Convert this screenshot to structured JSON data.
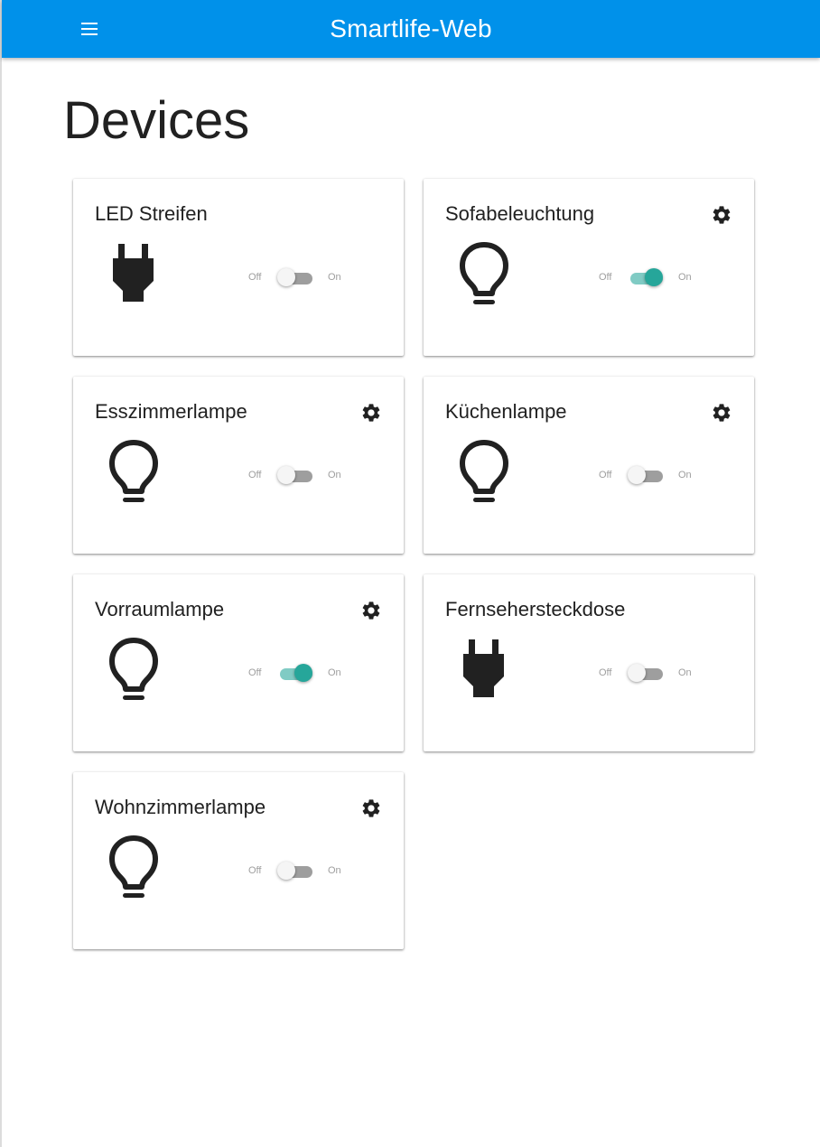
{
  "app": {
    "title": "Smartlife-Web",
    "menu_icon": "hamburger-menu-icon"
  },
  "page": {
    "title": "Devices"
  },
  "toggle_labels": {
    "off": "Off",
    "on": "On"
  },
  "colors": {
    "appbar": "#0091ea",
    "switch_on": "#26a69a",
    "switch_on_track": "#80cbc4",
    "switch_off_track": "#9e9e9e"
  },
  "devices": [
    {
      "name": "LED Streifen",
      "type": "plug",
      "icon": "plug-icon",
      "has_settings": false,
      "on": false
    },
    {
      "name": "Sofabeleuchtung",
      "type": "light",
      "icon": "lightbulb-icon",
      "has_settings": true,
      "on": true
    },
    {
      "name": "Esszimmerlampe",
      "type": "light",
      "icon": "lightbulb-icon",
      "has_settings": true,
      "on": false
    },
    {
      "name": "Küchenlampe",
      "type": "light",
      "icon": "lightbulb-icon",
      "has_settings": true,
      "on": false
    },
    {
      "name": "Vorraumlampe",
      "type": "light",
      "icon": "lightbulb-icon",
      "has_settings": true,
      "on": true
    },
    {
      "name": "Fernsehersteckdose",
      "type": "plug",
      "icon": "plug-icon",
      "has_settings": false,
      "on": false
    },
    {
      "name": "Wohnzimmerlampe",
      "type": "light",
      "icon": "lightbulb-icon",
      "has_settings": true,
      "on": false
    }
  ]
}
